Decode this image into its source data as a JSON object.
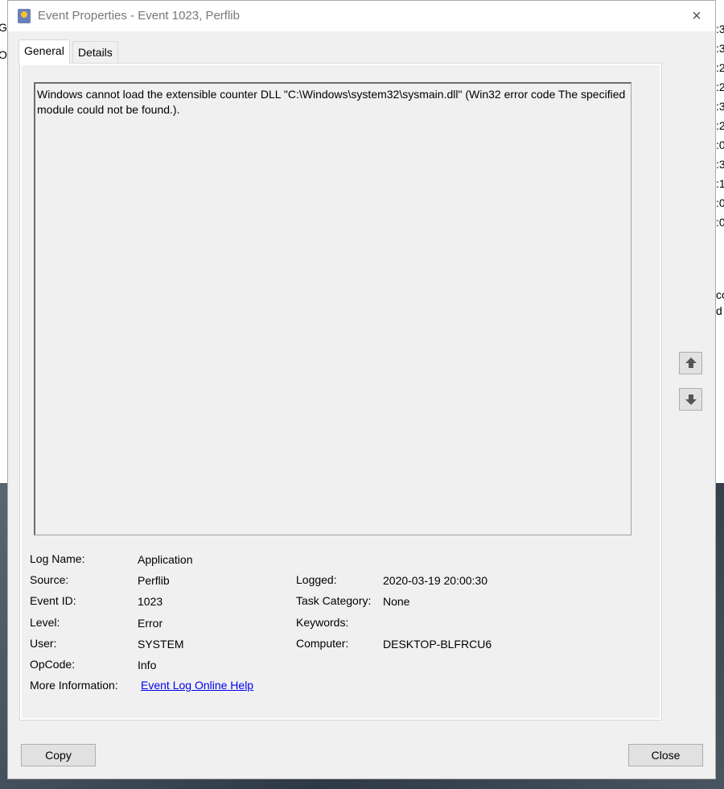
{
  "window": {
    "title": "Event Properties - Event 1023, Perflib",
    "close_glyph": "×"
  },
  "tabs": [
    {
      "label": "General",
      "active": true
    },
    {
      "label": "Details",
      "active": false
    }
  ],
  "description": "Windows cannot load the extensible counter DLL \"C:\\Windows\\system32\\sysmain.dll\" (Win32 error code The specified module could not be found.).",
  "fields_left": [
    {
      "label": "Log Name:",
      "value": "Application"
    },
    {
      "label": "Source:",
      "value": "Perflib"
    },
    {
      "label": "Event ID:",
      "value": "1023"
    },
    {
      "label": "Level:",
      "value": "Error"
    },
    {
      "label": "User:",
      "value": "SYSTEM"
    },
    {
      "label": "OpCode:",
      "value": "Info"
    },
    {
      "label": "More Information:",
      "value": "Event Log Online Help"
    }
  ],
  "fields_right": [
    {
      "label": "Logged:",
      "value": "2020-03-19 20:00:30"
    },
    {
      "label": "Task Category:",
      "value": "None"
    },
    {
      "label": "Keywords:",
      "value": ""
    },
    {
      "label": "Computer:",
      "value": "DESKTOP-BLFRCU6"
    }
  ],
  "buttons": {
    "copy": "Copy",
    "close": "Close",
    "prev_icon": "arrow-up-icon",
    "next_icon": "arrow-down-icon"
  },
  "background_right": [
    ":3",
    ":3",
    ":2",
    ":2",
    ":3",
    ":2",
    ":0",
    ":3",
    ":1",
    ":0",
    ":0",
    "co",
    "d"
  ],
  "background_left": [
    "Ge",
    "O"
  ]
}
